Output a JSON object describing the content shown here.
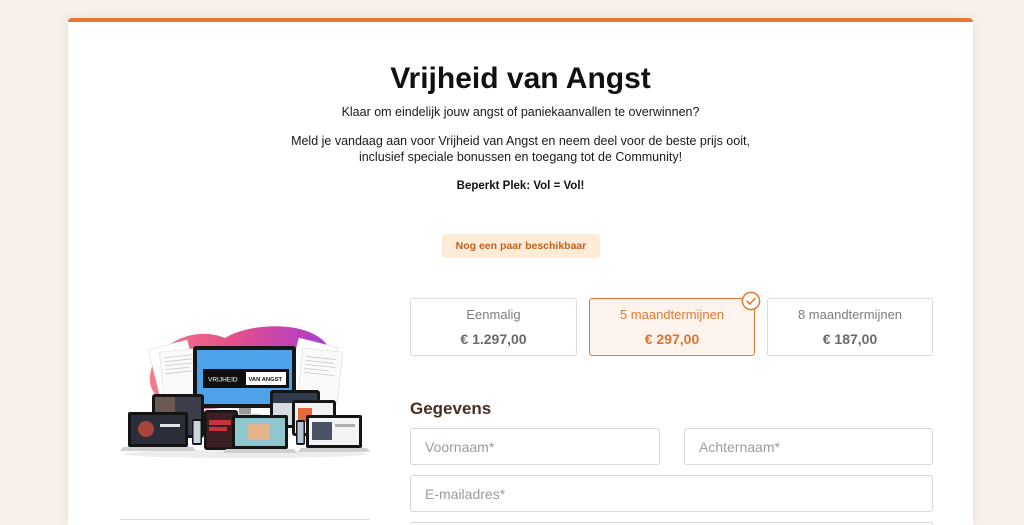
{
  "theme": {
    "page_background": "#f7f1ea",
    "accent": "#e8782f",
    "badge_background": "#fdecd8",
    "badge_text": "#c4601f",
    "heading_brown": "#4a2e20",
    "selected_background": "#fdf4ee"
  },
  "header": {
    "title": "Vrijheid van Angst",
    "subtitle": "Klaar om eindelijk jouw angst of paniekaanvallen te overwinnen?",
    "intro_line1": "Meld je vandaag aan voor Vrijheid van Angst en neem deel voor de beste prijs ooit,",
    "intro_line2": "inclusief speciale bonussen en toegang tot de Community!",
    "notice": "Beperkt Plek: Vol = Vol!"
  },
  "availability_badge": {
    "label": "Nog een paar beschikbaar"
  },
  "product_image": {
    "logo_left": "VRIJHEID",
    "logo_right": "VAN ANGST"
  },
  "pricing": {
    "selected_index": 1,
    "selected_icon": "check-circle-icon",
    "options": [
      {
        "label": "Eenmalig",
        "price": "€ 1.297,00"
      },
      {
        "label": "5 maandtermijnen",
        "price": "€ 297,00"
      },
      {
        "label": "8 maandtermijnen",
        "price": "€ 187,00"
      }
    ]
  },
  "form": {
    "heading": "Gegevens",
    "first_name": {
      "placeholder": "Voornaam*",
      "value": ""
    },
    "last_name": {
      "placeholder": "Achternaam*",
      "value": ""
    },
    "email": {
      "placeholder": "E-mailadres*",
      "value": ""
    }
  }
}
